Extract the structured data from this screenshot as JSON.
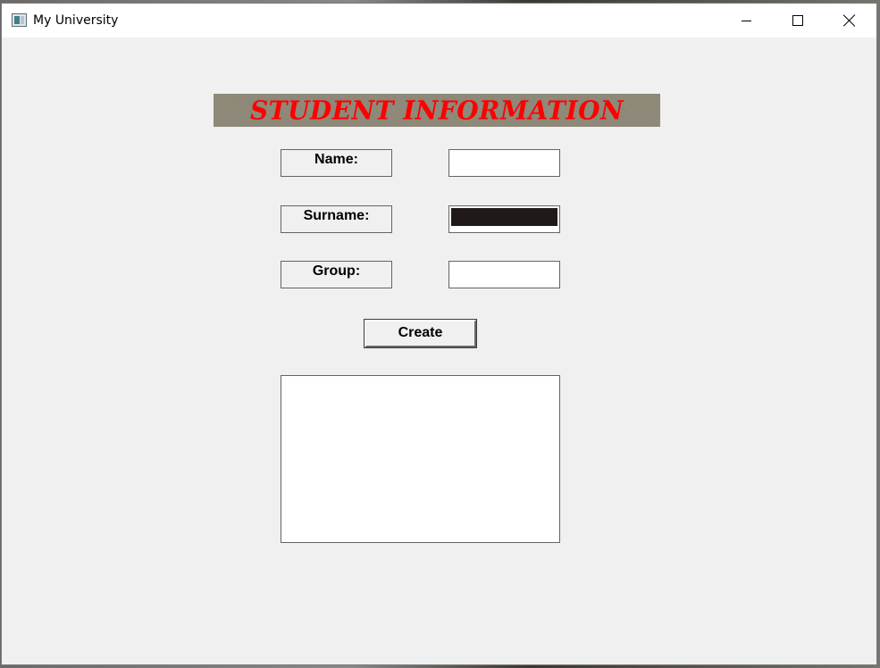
{
  "window": {
    "title": "My University",
    "icon": "app-window-icon",
    "controls": [
      "minimize-icon",
      "maximize-icon",
      "close-icon"
    ]
  },
  "form": {
    "banner": "STUDENT INFORMATION",
    "banner_color": "#ff0000",
    "banner_bg": "#8e8878",
    "fields": {
      "name": {
        "label": "Name:",
        "value": ""
      },
      "surname": {
        "label": "Surname:",
        "value": ""
      },
      "group": {
        "label": "Group:",
        "value": ""
      }
    },
    "create_label": "Create",
    "output_text": ""
  }
}
